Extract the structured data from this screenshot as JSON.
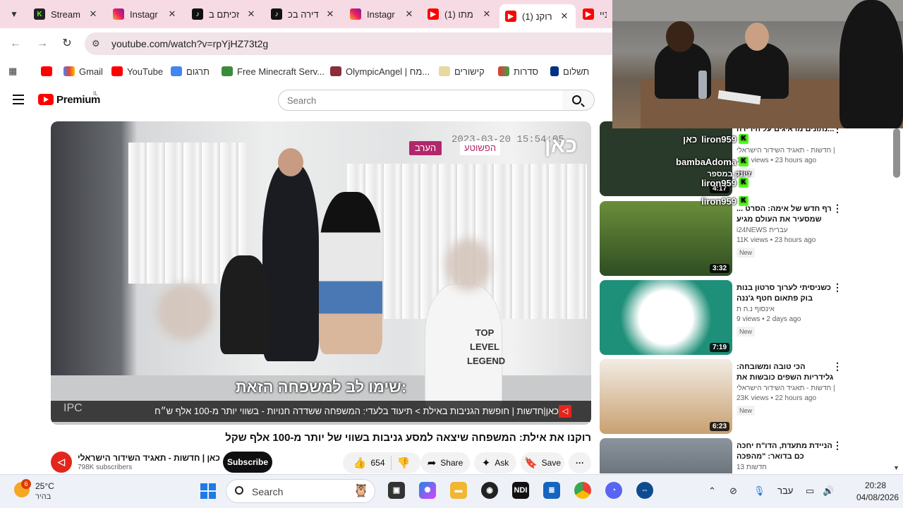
{
  "tabs": [
    {
      "label": "Stream",
      "favicon": "kick-icon"
    },
    {
      "label": "Instagr",
      "favicon": "instagram-icon"
    },
    {
      "label": "זכיתם ב",
      "favicon": "tiktok-icon"
    },
    {
      "label": "דירה בכ",
      "favicon": "tiktok-icon"
    },
    {
      "label": "Instagr",
      "favicon": "instagram-icon"
    },
    {
      "label": "(1) מתו",
      "favicon": "youtube-icon"
    },
    {
      "label": "(1) רוקנ",
      "favicon": "youtube-icon",
      "active": true
    },
    {
      "label": "ניי",
      "favicon": "youtube-icon"
    }
  ],
  "address_bar": {
    "url": "youtube.com/watch?v=rpYjHZ73t2g"
  },
  "bookmarks": [
    {
      "label": "",
      "icon": "youtube-icon"
    },
    {
      "label": "Gmail",
      "icon": "gmail-icon"
    },
    {
      "label": "YouTube",
      "icon": "youtube-icon"
    },
    {
      "label": "תרגום",
      "icon": "translate-icon"
    },
    {
      "label": "Free Minecraft Serv...",
      "icon": "minecraft-icon"
    },
    {
      "label": "OlympicAngel | מח...",
      "icon": "avatar-icon"
    },
    {
      "label": "קישורים",
      "icon": "star-icon"
    },
    {
      "label": "סדרות",
      "icon": "folder-icon"
    },
    {
      "label": "תשלום",
      "icon": "paypal-icon"
    }
  ],
  "youtube_header": {
    "brand": "Premium",
    "country": "IL",
    "search_placeholder": "Search"
  },
  "player": {
    "broadcaster": "כאן",
    "timestamp": "2023-03-20 15:54:05",
    "badge_a": "הערב",
    "badge_b": "הפשוטע",
    "subtitle": "שימו לב למשפחה הזאת:",
    "lower_third": "כאן|חדשות | חופשת הגניבות באילת > תיעוד בלעדי: המשפחה ששדדה חנויות - בשווי יותר מ-100 אלף ש״ח",
    "camera_brand": "IPC",
    "shirt_text": "TOP LEVEL LEGEND"
  },
  "video": {
    "title": "רוקנו את אילת: המשפחה שיצאה למסע גניבות בשווי של יותר מ-100 אלף שקל",
    "channel_name": "כאן | חדשות - תאגיד השידור הישראלי",
    "channel_initial": "כאן",
    "subscribers": "798K subscribers",
    "subscribe_label": "Subscribe",
    "likes": "654",
    "share_label": "Share",
    "ask_label": "Ask",
    "save_label": "Save"
  },
  "chat_overlay": [
    {
      "user": "liron959",
      "message": "כאן"
    },
    {
      "user": "bambaAdoma",
      "message": "זיונק במספר"
    },
    {
      "user": "liron959",
      "message": ""
    },
    {
      "user": "liron959",
      "message": ""
    }
  ],
  "recommendations": [
    {
      "title": "...נתונים מדאיגים על הירידה",
      "channel": "כאן | חדשות - תאגיד השידור הישראלי",
      "meta": "14K views • 23 hours ago",
      "badge": "New",
      "duration": "4:17",
      "thumb_color": "#2a3a2a"
    },
    {
      "title": "רף חדש של אימה: הסרט ... שמסעיר את העולם מגיע",
      "channel": "i24NEWS עברית",
      "meta": "11K views • 23 hours ago",
      "badge": "New",
      "duration": "3:32",
      "thumb_color": "#3c5a2c"
    },
    {
      "title": "כשניסיתי לערוך סרטון בנות בוק פתאום חטף ג'ננה והתחיל AI-...",
      "channel": "אינסוף נ.ח ת",
      "meta": "9 views • 2 days ago",
      "badge": "New",
      "duration": "7:19",
      "thumb_color": "#1e8f78"
    },
    {
      "title": "הכי טובה ומשובחה: גלידריות השפים כובשות את ישראל",
      "channel": "כאן | חדשות - תאגיד השידור הישראלי",
      "meta": "23K views • 22 hours ago",
      "badge": "New",
      "duration": "6:23",
      "thumb_color": "#c9a070"
    },
    {
      "title": "הניידת מתעדת, הדו\"ח יחכה כם בדואר: \"מהפכה המצלמות\"",
      "channel": "חדשות 13",
      "meta": "",
      "badge": "",
      "duration": "",
      "thumb_color": "#5a6470"
    }
  ],
  "taskbar": {
    "weather_temp": "25°C",
    "weather_cond": "בהיר",
    "weather_badge": "6",
    "search_label": "Search",
    "language": "עבר",
    "time": "20:28",
    "date": "04/08/2026"
  },
  "colors": {
    "youtube_red": "#ff0000",
    "tab_strip": "#f7dbe4",
    "kan_red": "#e3261c",
    "kick_green": "#53fc18"
  }
}
